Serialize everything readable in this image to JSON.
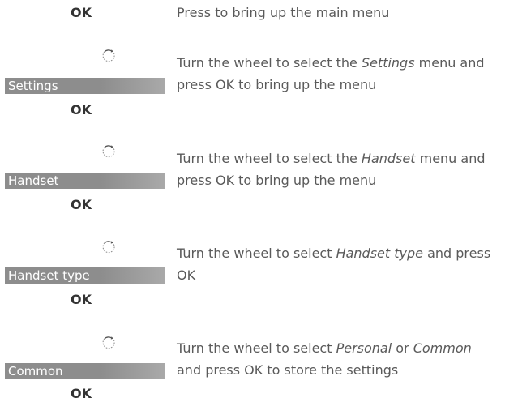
{
  "ok_label": "OK",
  "steps": [
    {
      "icon": "ok-button",
      "instruction": [
        "Press to bring up the main menu"
      ]
    },
    {
      "icon": "wheel-turn-icon",
      "menu_item": "Settings",
      "instruction": [
        "Turn the wheel to select the ",
        "Settings",
        " menu and",
        "press OK to bring up the menu"
      ]
    },
    {
      "icon": "wheel-turn-icon",
      "menu_item": "Handset",
      "instruction": [
        "Turn the wheel to select the ",
        "Handset",
        " menu and",
        "press OK to bring up the menu"
      ]
    },
    {
      "icon": "wheel-turn-icon",
      "menu_item": "Handset type",
      "instruction": [
        "Turn the wheel to select ",
        "Handset type",
        " and press",
        "OK"
      ]
    },
    {
      "icon": "wheel-turn-icon",
      "menu_item": "Common",
      "instruction": [
        "Turn the wheel to select ",
        "Personal",
        " or ",
        "Common",
        "and press OK to store the settings"
      ]
    }
  ]
}
